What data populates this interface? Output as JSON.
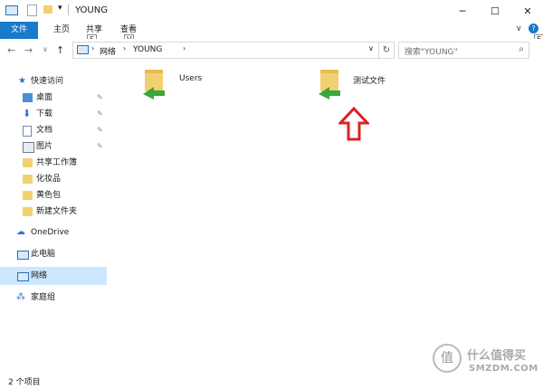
{
  "window": {
    "title": "YOUNG"
  },
  "ribbon": {
    "tabs": [
      {
        "label": "文件"
      },
      {
        "label": "主页"
      },
      {
        "label": "共享"
      },
      {
        "label": "查看"
      }
    ],
    "keytips": [
      "S",
      "V",
      "E"
    ]
  },
  "address": {
    "segments": [
      "网络",
      "YOUNG"
    ],
    "search_placeholder": "搜索\"YOUNG\""
  },
  "nav": {
    "quick_access": "快速访问",
    "items": [
      {
        "label": "桌面",
        "pinned": true
      },
      {
        "label": "下载",
        "pinned": true
      },
      {
        "label": "文档",
        "pinned": true
      },
      {
        "label": "图片",
        "pinned": true
      },
      {
        "label": "共享工作簿",
        "pinned": false
      },
      {
        "label": "化妆品",
        "pinned": false
      },
      {
        "label": "黄色包",
        "pinned": false
      },
      {
        "label": "新建文件夹",
        "pinned": false
      }
    ],
    "onedrive": "OneDrive",
    "this_pc": "此电脑",
    "network": "网络",
    "homegroup": "家庭组"
  },
  "content": {
    "items": [
      {
        "label": "Users"
      },
      {
        "label": "测试文件"
      }
    ]
  },
  "status": {
    "count": "2 个项目"
  },
  "watermark": {
    "text": "什么值得买",
    "sub": "SMZDM.COM"
  },
  "colors": {
    "accent": "#1979ca",
    "selection": "#cce8ff",
    "folder": "#f3d06f",
    "annotation": "#e02020",
    "share": "#3aa83a"
  }
}
